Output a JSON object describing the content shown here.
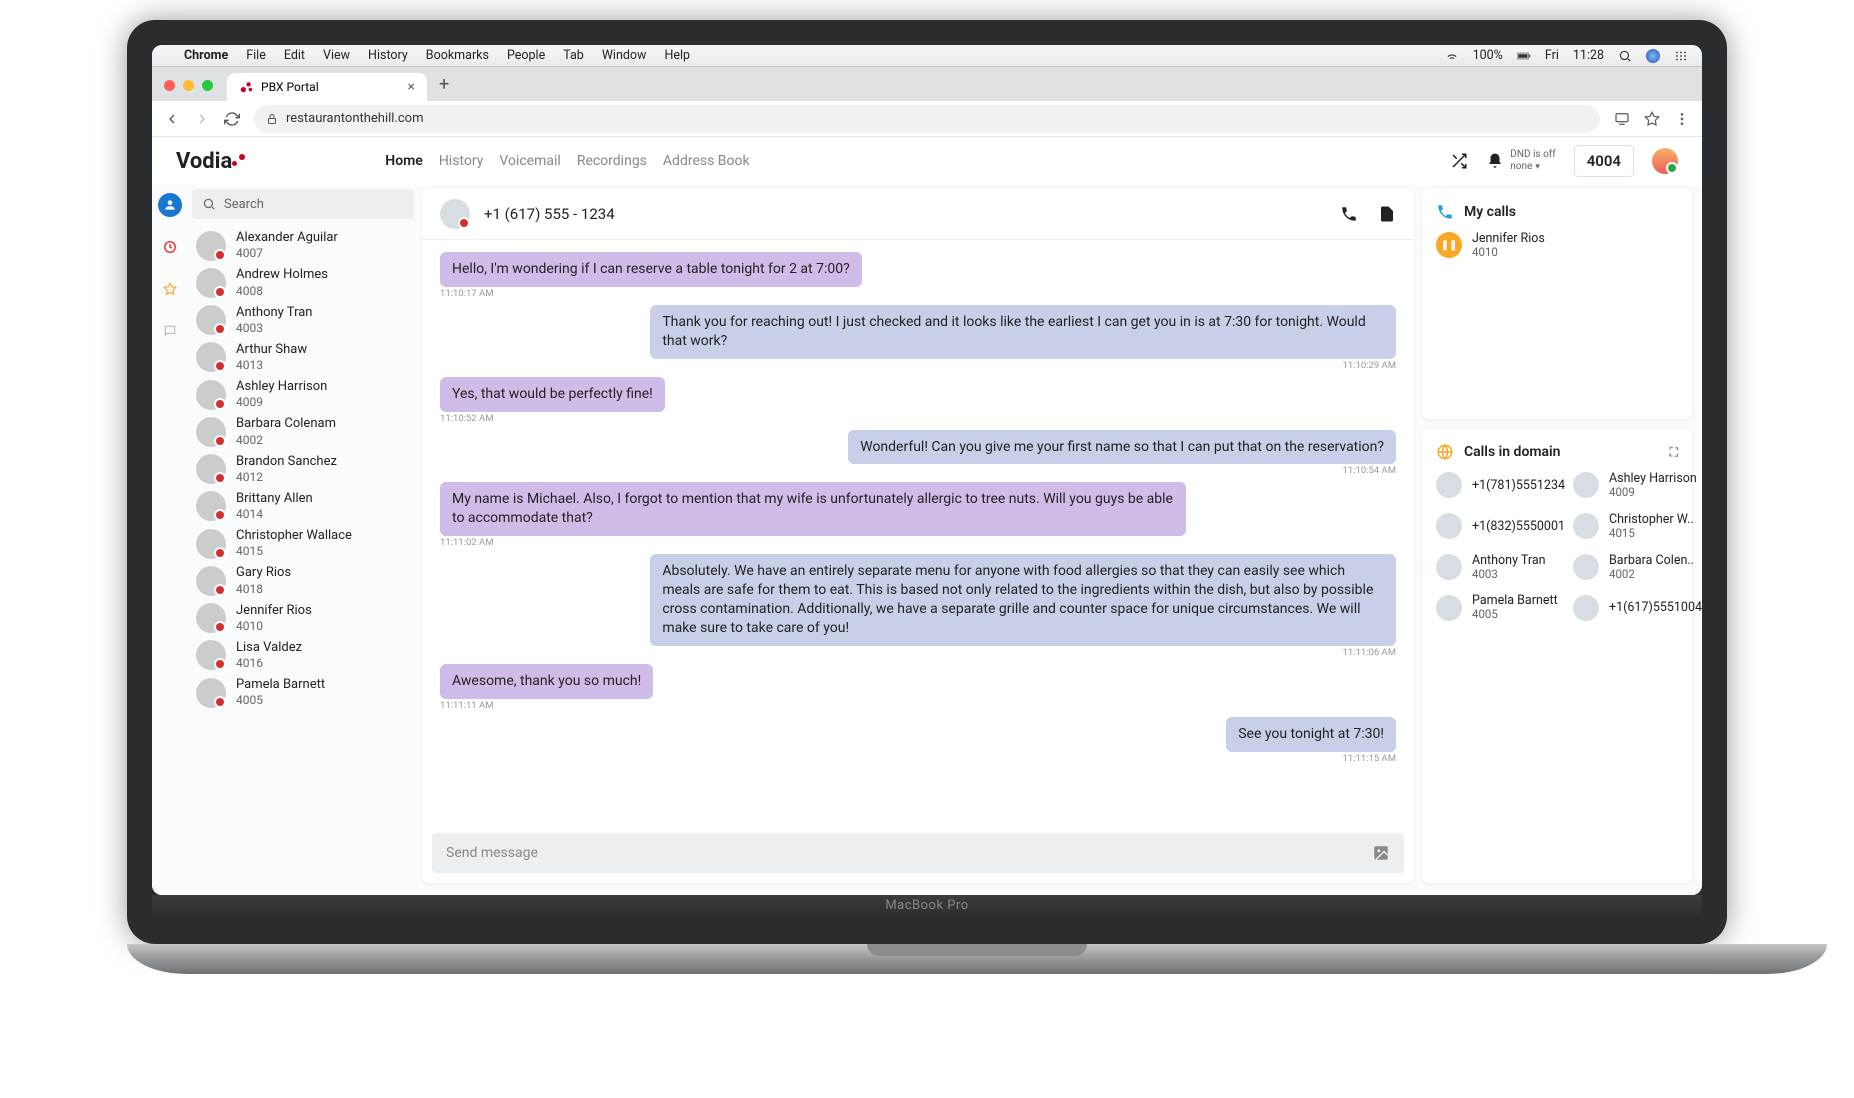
{
  "menubar": {
    "app": "Chrome",
    "items": [
      "File",
      "Edit",
      "View",
      "History",
      "Bookmarks",
      "People",
      "Tab",
      "Window",
      "Help"
    ],
    "battery": "100%",
    "dow": "Fri",
    "time": "11:28"
  },
  "browser": {
    "tab_title": "PBX Portal",
    "url": "restaurantonthehill.com"
  },
  "header": {
    "brand": "Vodia",
    "nav": [
      "Home",
      "History",
      "Voicemail",
      "Recordings",
      "Address Book"
    ],
    "active": "Home",
    "dnd_line1": "DND is off",
    "dnd_line2": "none",
    "extension": "4004"
  },
  "search_placeholder": "Search",
  "contacts": [
    {
      "name": "Alexander Aguilar",
      "ext": "4007"
    },
    {
      "name": "Andrew Holmes",
      "ext": "4008"
    },
    {
      "name": "Anthony Tran",
      "ext": "4003"
    },
    {
      "name": "Arthur Shaw",
      "ext": "4013"
    },
    {
      "name": "Ashley Harrison",
      "ext": "4009"
    },
    {
      "name": "Barbara Colenam",
      "ext": "4002"
    },
    {
      "name": "Brandon Sanchez",
      "ext": "4012"
    },
    {
      "name": "Brittany Allen",
      "ext": "4014"
    },
    {
      "name": "Christopher Wallace",
      "ext": "4015"
    },
    {
      "name": "Gary Rios",
      "ext": "4018"
    },
    {
      "name": "Jennifer Rios",
      "ext": "4010"
    },
    {
      "name": "Lisa Valdez",
      "ext": "4016"
    },
    {
      "name": "Pamela Barnett",
      "ext": "4005"
    }
  ],
  "chat": {
    "number": "+1 (617) 555 - 1234",
    "messages": [
      {
        "dir": "in",
        "text": "Hello, I'm wondering if I can reserve a table tonight for 2 at 7:00?",
        "ts": "11:10:17 AM"
      },
      {
        "dir": "out",
        "text": "Thank you for reaching out! I just checked and it looks like the earliest I can get you in is at 7:30 for tonight. Would that work?",
        "ts": "11:10:29 AM"
      },
      {
        "dir": "in",
        "text": "Yes, that would be perfectly fine!",
        "ts": "11:10:52 AM"
      },
      {
        "dir": "out",
        "text": "Wonderful! Can you give me your first name so that I can put that on the reservation?",
        "ts": "11:10:54 AM"
      },
      {
        "dir": "in",
        "text": "My name is Michael. Also, I forgot to mention that my wife is unfortunately allergic to tree nuts. Will you guys be able to accommodate that?",
        "ts": "11:11:02 AM"
      },
      {
        "dir": "out",
        "text": "Absolutely. We have an entirely separate menu for anyone with food allergies so that they can easily see which meals are safe for them to eat. This is based not only related to the ingredients within the dish, but also by possible cross contamination. Additionally, we have a separate grille and counter space for unique circumstances. We will make sure to take care of you!",
        "ts": "11:11:06 AM"
      },
      {
        "dir": "in",
        "text": "Awesome, thank you so much!",
        "ts": "11:11:11 AM"
      },
      {
        "dir": "out",
        "text": "See you tonight at 7:30!",
        "ts": "11:11:15 AM"
      }
    ],
    "compose_placeholder": "Send message"
  },
  "mycalls": {
    "title": "My calls",
    "items": [
      {
        "name": "Jennifer Rios",
        "ext": "4010"
      }
    ]
  },
  "domain": {
    "title": "Calls in domain",
    "items": [
      {
        "name": "+1(781)5551234",
        "ext": ""
      },
      {
        "name": "Ashley Harrison",
        "ext": "4009"
      },
      {
        "name": "+1(832)5550001",
        "ext": ""
      },
      {
        "name": "Christopher W..",
        "ext": "4015"
      },
      {
        "name": "Anthony Tran",
        "ext": "4003"
      },
      {
        "name": "Barbara Colen..",
        "ext": "4002"
      },
      {
        "name": "Pamela Barnett",
        "ext": "4005"
      },
      {
        "name": "+1(617)5551004",
        "ext": ""
      }
    ]
  },
  "laptop_label": "MacBook Pro"
}
